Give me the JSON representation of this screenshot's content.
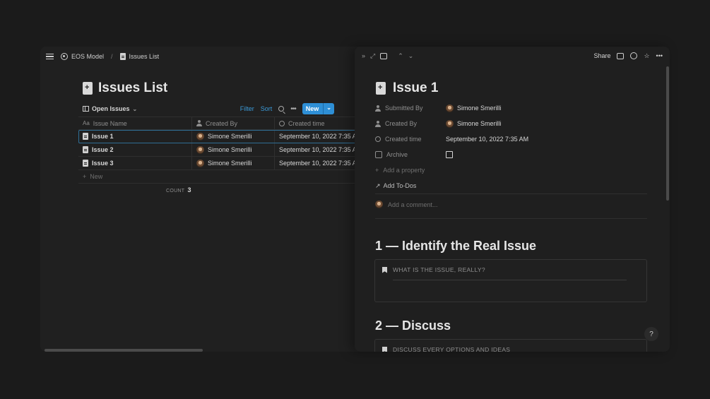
{
  "breadcrumb": {
    "workspace": "EOS Model",
    "page": "Issues List"
  },
  "list_page": {
    "title": "Issues List",
    "view_label": "Open Issues",
    "actions": {
      "filter": "Filter",
      "sort": "Sort",
      "new": "New"
    },
    "columns": [
      "Issue Name",
      "Created By",
      "Created time"
    ],
    "rows": [
      {
        "name": "Issue 1",
        "created_by": "Simone Smerilli",
        "created_time": "September 10, 2022 7:35 A"
      },
      {
        "name": "Issue 2",
        "created_by": "Simone Smerilli",
        "created_time": "September 10, 2022 7:35 A"
      },
      {
        "name": "Issue 3",
        "created_by": "Simone Smerilli",
        "created_time": "September 10, 2022 7:35 A"
      }
    ],
    "new_row_label": "New",
    "count_label": "COUNT",
    "count_value": "3"
  },
  "peek": {
    "topbar": {
      "share": "Share"
    },
    "title": "Issue 1",
    "properties": [
      {
        "key": "Submitted By",
        "value": "Simone Smerilli"
      },
      {
        "key": "Created By",
        "value": "Simone Smerilli"
      },
      {
        "key": "Created time",
        "value": "September 10, 2022 7:35 AM"
      },
      {
        "key": "Archive",
        "value": ""
      }
    ],
    "add_property": "Add a property",
    "add_todos": "Add To-Dos",
    "comment_placeholder": "Add a comment...",
    "sections": [
      {
        "heading": "1 — Identify the Real Issue",
        "callout": "WHAT IS THE ISSUE, REALLY?"
      },
      {
        "heading": "2 — Discuss",
        "callout": "DISCUSS EVERY OPTIONS AND IDEAS"
      }
    ]
  },
  "help_label": "?",
  "colors": {
    "background": "#1b1b1b",
    "panel": "#202020",
    "accent": "#2e8fd6",
    "link": "#3b9ad8"
  }
}
